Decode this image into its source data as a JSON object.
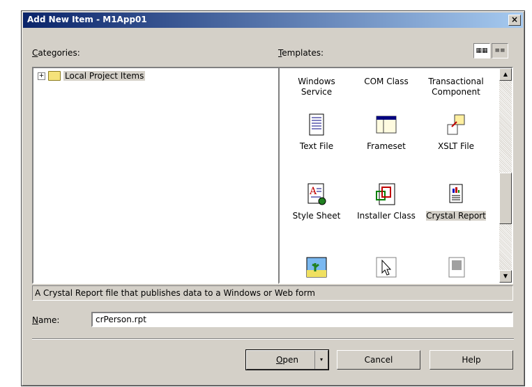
{
  "window": {
    "title": "Add New Item - M1App01",
    "close": "×"
  },
  "categories": {
    "label_underline": "C",
    "label_rest": "ategories:",
    "items": [
      {
        "label": "Local Project Items",
        "expander": "+"
      }
    ]
  },
  "templates": {
    "label_underline": "T",
    "label_rest": "emplates:",
    "items": [
      {
        "label": "Windows Service",
        "icon": "service-icon"
      },
      {
        "label": "COM Class",
        "icon": "com-class-icon"
      },
      {
        "label": "Transactional Component",
        "icon": "transaction-icon"
      },
      {
        "label": "Text File",
        "icon": "text-file-icon"
      },
      {
        "label": "Frameset",
        "icon": "frameset-icon"
      },
      {
        "label": "XSLT File",
        "icon": "xslt-file-icon"
      },
      {
        "label": "Style Sheet",
        "icon": "style-sheet-icon"
      },
      {
        "label": "Installer Class",
        "icon": "installer-class-icon"
      },
      {
        "label": "Crystal Report",
        "icon": "crystal-report-icon",
        "selected": true
      },
      {
        "label": "",
        "icon": "bitmap-icon"
      },
      {
        "label": "",
        "icon": "cursor-icon"
      },
      {
        "label": "",
        "icon": "icon-file-icon"
      }
    ]
  },
  "view_buttons": {
    "large_icons": "large-icons-view-icon",
    "small_icons": "list-view-icon"
  },
  "description": "A Crystal Report file that publishes data to a Windows or Web form",
  "name_field": {
    "label_underline": "N",
    "label_rest": "ame:",
    "value": "crPerson.rpt"
  },
  "buttons": {
    "open_underline": "O",
    "open_rest": "pen",
    "open_arrow": "▾",
    "cancel": "Cancel",
    "help": "Help"
  },
  "scrollbar": {
    "up": "▲",
    "down": "▼"
  }
}
